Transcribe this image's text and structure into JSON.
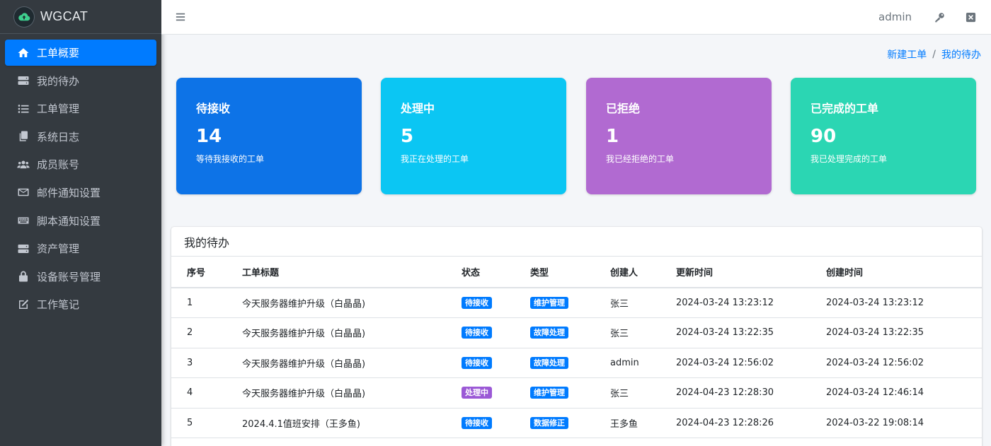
{
  "brand": {
    "name": "WGCAT"
  },
  "sidebar": {
    "items": [
      {
        "label": "工单概要",
        "icon": "home-icon",
        "active": true
      },
      {
        "label": "我的待办",
        "icon": "server-icon"
      },
      {
        "label": "工单管理",
        "icon": "list-icon"
      },
      {
        "label": "系统日志",
        "icon": "copy-icon"
      },
      {
        "label": "成员账号",
        "icon": "users-icon"
      },
      {
        "label": "邮件通知设置",
        "icon": "envelope-icon"
      },
      {
        "label": "脚本通知设置",
        "icon": "keyboard-icon"
      },
      {
        "label": "资产管理",
        "icon": "server-icon"
      },
      {
        "label": "设备账号管理",
        "icon": "lock-icon"
      },
      {
        "label": "工作笔记",
        "icon": "edit-icon"
      }
    ]
  },
  "header": {
    "user": "admin"
  },
  "breadcrumb": {
    "link": "新建工单",
    "current": "我的待办"
  },
  "cards": [
    {
      "title": "待接收",
      "value": "14",
      "desc": "等待我接收的工单",
      "color": "#0d73e7"
    },
    {
      "title": "处理中",
      "value": "5",
      "desc": "我正在处理的工单",
      "color": "#0bc6f3"
    },
    {
      "title": "已拒绝",
      "value": "1",
      "desc": "我已经拒绝的工单",
      "color": "#b16ad1"
    },
    {
      "title": "已完成的工单",
      "value": "90",
      "desc": "我已处理完成的工单",
      "color": "#2bd6b3"
    }
  ],
  "todo": {
    "title": "我的待办",
    "columns": [
      "序号",
      "工单标题",
      "状态",
      "类型",
      "创建人",
      "更新时间",
      "创建时间"
    ],
    "rows": [
      {
        "idx": "1",
        "title": "今天服务器维护升级（白晶晶)",
        "status": "待接收",
        "type": "维护管理",
        "creator": "张三",
        "updated": "2024-03-24 13:23:12",
        "created": "2024-03-24 13:23:12"
      },
      {
        "idx": "2",
        "title": "今天服务器维护升级（白晶晶)",
        "status": "待接收",
        "type": "故障处理",
        "creator": "张三",
        "updated": "2024-03-24 13:22:35",
        "created": "2024-03-24 13:22:35"
      },
      {
        "idx": "3",
        "title": "今天服务器维护升级（白晶晶)",
        "status": "待接收",
        "type": "故障处理",
        "creator": "admin",
        "updated": "2024-03-24 12:56:02",
        "created": "2024-03-24 12:56:02"
      },
      {
        "idx": "4",
        "title": "今天服务器维护升级（白晶晶)",
        "status": "处理中",
        "type": "维护管理",
        "creator": "张三",
        "updated": "2024-04-23 12:28:30",
        "created": "2024-03-24 12:46:14"
      },
      {
        "idx": "5",
        "title": "2024.4.1值班安排（王多鱼)",
        "status": "待接收",
        "type": "数据修正",
        "creator": "王多鱼",
        "updated": "2024-04-23 12:28:26",
        "created": "2024-03-22 19:08:14"
      }
    ]
  },
  "colors": {
    "status_pending": "#007bff",
    "status_processing": "#9b59d6",
    "type_badge": "#007bff",
    "sidebar_bg": "#343a40",
    "active_nav": "#007bff"
  }
}
